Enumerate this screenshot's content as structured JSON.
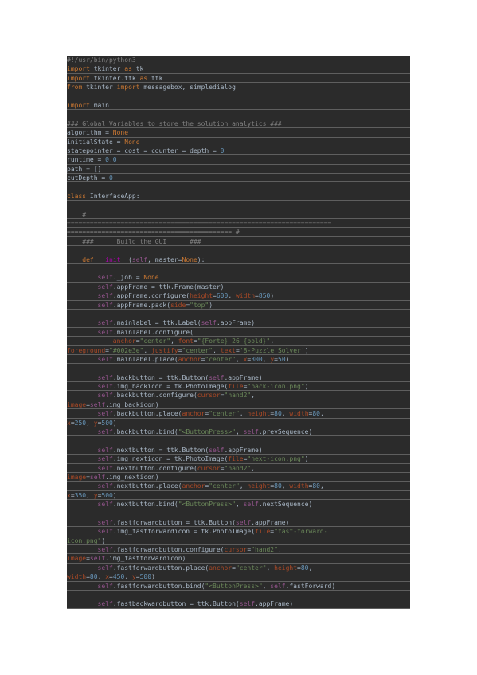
{
  "document": {
    "language": "python",
    "lines": [
      [
        [
          "#!/usr/bin/python3",
          "com"
        ]
      ],
      [
        [
          "import",
          "kw"
        ],
        [
          " tkinter ",
          ""
        ],
        [
          "as",
          "kw"
        ],
        [
          " tk",
          ""
        ]
      ],
      [
        [
          "import",
          "kw"
        ],
        [
          " tkinter.ttk ",
          ""
        ],
        [
          "as",
          "kw"
        ],
        [
          " ttk",
          ""
        ]
      ],
      [
        [
          "from",
          "kw"
        ],
        [
          " tkinter ",
          ""
        ],
        [
          "import",
          "kw"
        ],
        [
          " messagebox, simpledialog",
          ""
        ]
      ],
      [],
      [
        [
          "import",
          "kw"
        ],
        [
          " main",
          ""
        ]
      ],
      [],
      [
        [
          "### Global Variables to store the solution analytics ###",
          "com"
        ]
      ],
      [
        [
          "algorithm = ",
          ""
        ],
        [
          "None",
          "kw"
        ]
      ],
      [
        [
          "initialState = ",
          ""
        ],
        [
          "None",
          "kw"
        ]
      ],
      [
        [
          "statepointer = cost = counter = depth = ",
          ""
        ],
        [
          "0",
          "num"
        ]
      ],
      [
        [
          "runtime = ",
          ""
        ],
        [
          "0.0",
          "num"
        ]
      ],
      [
        [
          "path = []",
          ""
        ]
      ],
      [
        [
          "cutDepth = ",
          ""
        ],
        [
          "0",
          "num"
        ]
      ],
      [],
      [
        [
          "class",
          "kw"
        ],
        [
          " InterfaceApp:",
          ""
        ]
      ],
      [],
      [
        [
          "    ",
          ""
        ],
        [
          "#",
          "com"
        ]
      ],
      [
        [
          "=====================================================================",
          "com"
        ]
      ],
      [
        [
          "=========================================== #",
          "com"
        ]
      ],
      [
        [
          "    ###      Build the GUI      ###",
          "com"
        ]
      ],
      [],
      [
        [
          "    ",
          ""
        ],
        [
          "def",
          "kw"
        ],
        [
          " ",
          ""
        ],
        [
          "__init__",
          "dunder"
        ],
        [
          "(",
          ""
        ],
        [
          "self",
          "self"
        ],
        [
          ", master=",
          ""
        ],
        [
          "None",
          "kw"
        ],
        [
          "):",
          ""
        ]
      ],
      [],
      [
        [
          "        ",
          ""
        ],
        [
          "self",
          "self"
        ],
        [
          "._job = ",
          ""
        ],
        [
          "None",
          "kw"
        ]
      ],
      [
        [
          "        ",
          ""
        ],
        [
          "self",
          "self"
        ],
        [
          ".appFrame = ttk.Frame(master)",
          ""
        ]
      ],
      [
        [
          "        ",
          ""
        ],
        [
          "self",
          "self"
        ],
        [
          ".appFrame.configure(",
          ""
        ],
        [
          "height",
          "param"
        ],
        [
          "=",
          ""
        ],
        [
          "600",
          "num"
        ],
        [
          ", ",
          ""
        ],
        [
          "width",
          "param"
        ],
        [
          "=",
          ""
        ],
        [
          "850",
          "num"
        ],
        [
          ")",
          ""
        ]
      ],
      [
        [
          "        ",
          ""
        ],
        [
          "self",
          "self"
        ],
        [
          ".appFrame.pack(",
          ""
        ],
        [
          "side",
          "param"
        ],
        [
          "=",
          ""
        ],
        [
          "\"top\"",
          "str"
        ],
        [
          ")",
          ""
        ]
      ],
      [],
      [
        [
          "        ",
          ""
        ],
        [
          "self",
          "self"
        ],
        [
          ".mainlabel = ttk.Label(",
          ""
        ],
        [
          "self",
          "self"
        ],
        [
          ".appFrame)",
          ""
        ]
      ],
      [
        [
          "        ",
          ""
        ],
        [
          "self",
          "self"
        ],
        [
          ".mainlabel.configure(",
          ""
        ]
      ],
      [
        [
          "            ",
          ""
        ],
        [
          "anchor",
          "param"
        ],
        [
          "=",
          ""
        ],
        [
          "\"center\"",
          "str"
        ],
        [
          ", ",
          ""
        ],
        [
          "font",
          "param"
        ],
        [
          "=",
          ""
        ],
        [
          "\"{Forte} 26 {bold}\"",
          "str"
        ],
        [
          ",",
          ""
        ]
      ],
      [
        [
          "foreground",
          "param"
        ],
        [
          "=",
          ""
        ],
        [
          "\"#002e3e\"",
          "str"
        ],
        [
          ", ",
          ""
        ],
        [
          "justify",
          "param"
        ],
        [
          "=",
          ""
        ],
        [
          "\"center\"",
          "str"
        ],
        [
          ", ",
          ""
        ],
        [
          "text",
          "param"
        ],
        [
          "=",
          ""
        ],
        [
          "'8-Puzzle Solver'",
          "str"
        ],
        [
          ")",
          ""
        ]
      ],
      [
        [
          "        ",
          ""
        ],
        [
          "self",
          "self"
        ],
        [
          ".mainlabel.place(",
          ""
        ],
        [
          "anchor",
          "param"
        ],
        [
          "=",
          ""
        ],
        [
          "\"center\"",
          "str"
        ],
        [
          ", ",
          ""
        ],
        [
          "x",
          "param"
        ],
        [
          "=",
          ""
        ],
        [
          "300",
          "num"
        ],
        [
          ", ",
          ""
        ],
        [
          "y",
          "param"
        ],
        [
          "=",
          ""
        ],
        [
          "50",
          "num"
        ],
        [
          ")",
          ""
        ]
      ],
      [],
      [
        [
          "        ",
          ""
        ],
        [
          "self",
          "self"
        ],
        [
          ".backbutton = ttk.Button(",
          ""
        ],
        [
          "self",
          "self"
        ],
        [
          ".appFrame)",
          ""
        ]
      ],
      [
        [
          "        ",
          ""
        ],
        [
          "self",
          "self"
        ],
        [
          ".img_backicon = tk.PhotoImage(",
          ""
        ],
        [
          "file",
          "param"
        ],
        [
          "=",
          ""
        ],
        [
          "\"back-icon.png\"",
          "str"
        ],
        [
          ")",
          ""
        ]
      ],
      [
        [
          "        ",
          ""
        ],
        [
          "self",
          "self"
        ],
        [
          ".backbutton.configure(",
          ""
        ],
        [
          "cursor",
          "param"
        ],
        [
          "=",
          ""
        ],
        [
          "\"hand2\"",
          "str"
        ],
        [
          ",",
          ""
        ]
      ],
      [
        [
          "image",
          "param"
        ],
        [
          "=",
          ""
        ],
        [
          "self",
          "self"
        ],
        [
          ".img_backicon)",
          ""
        ]
      ],
      [
        [
          "        ",
          ""
        ],
        [
          "self",
          "self"
        ],
        [
          ".backbutton.place(",
          ""
        ],
        [
          "anchor",
          "param"
        ],
        [
          "=",
          ""
        ],
        [
          "\"center\"",
          "str"
        ],
        [
          ", ",
          ""
        ],
        [
          "height",
          "param"
        ],
        [
          "=",
          ""
        ],
        [
          "80",
          "num"
        ],
        [
          ", ",
          ""
        ],
        [
          "width",
          "param"
        ],
        [
          "=",
          ""
        ],
        [
          "80",
          "num"
        ],
        [
          ",",
          ""
        ]
      ],
      [
        [
          "x",
          "param"
        ],
        [
          "=",
          ""
        ],
        [
          "250",
          "num"
        ],
        [
          ", ",
          ""
        ],
        [
          "y",
          "param"
        ],
        [
          "=",
          ""
        ],
        [
          "500",
          "num"
        ],
        [
          ")",
          ""
        ]
      ],
      [
        [
          "        ",
          ""
        ],
        [
          "self",
          "self"
        ],
        [
          ".backbutton.bind(",
          ""
        ],
        [
          "\"<ButtonPress>\"",
          "str"
        ],
        [
          ", ",
          ""
        ],
        [
          "self",
          "self"
        ],
        [
          ".prevSequence)",
          ""
        ]
      ],
      [],
      [
        [
          "        ",
          ""
        ],
        [
          "self",
          "self"
        ],
        [
          ".nextbutton = ttk.Button(",
          ""
        ],
        [
          "self",
          "self"
        ],
        [
          ".appFrame)",
          ""
        ]
      ],
      [
        [
          "        ",
          ""
        ],
        [
          "self",
          "self"
        ],
        [
          ".img_nexticon = tk.PhotoImage(",
          ""
        ],
        [
          "file",
          "param"
        ],
        [
          "=",
          ""
        ],
        [
          "\"next-icon.png\"",
          "str"
        ],
        [
          ")",
          ""
        ]
      ],
      [
        [
          "        ",
          ""
        ],
        [
          "self",
          "self"
        ],
        [
          ".nextbutton.configure(",
          ""
        ],
        [
          "cursor",
          "param"
        ],
        [
          "=",
          ""
        ],
        [
          "\"hand2\"",
          "str"
        ],
        [
          ",",
          ""
        ]
      ],
      [
        [
          "image",
          "param"
        ],
        [
          "=",
          ""
        ],
        [
          "self",
          "self"
        ],
        [
          ".img_nexticon)",
          ""
        ]
      ],
      [
        [
          "        ",
          ""
        ],
        [
          "self",
          "self"
        ],
        [
          ".nextbutton.place(",
          ""
        ],
        [
          "anchor",
          "param"
        ],
        [
          "=",
          ""
        ],
        [
          "\"center\"",
          "str"
        ],
        [
          ", ",
          ""
        ],
        [
          "height",
          "param"
        ],
        [
          "=",
          ""
        ],
        [
          "80",
          "num"
        ],
        [
          ", ",
          ""
        ],
        [
          "width",
          "param"
        ],
        [
          "=",
          ""
        ],
        [
          "80",
          "num"
        ],
        [
          ",",
          ""
        ]
      ],
      [
        [
          "x",
          "param"
        ],
        [
          "=",
          ""
        ],
        [
          "350",
          "num"
        ],
        [
          ", ",
          ""
        ],
        [
          "y",
          "param"
        ],
        [
          "=",
          ""
        ],
        [
          "500",
          "num"
        ],
        [
          ")",
          ""
        ]
      ],
      [
        [
          "        ",
          ""
        ],
        [
          "self",
          "self"
        ],
        [
          ".nextbutton.bind(",
          ""
        ],
        [
          "\"<ButtonPress>\"",
          "str"
        ],
        [
          ", ",
          ""
        ],
        [
          "self",
          "self"
        ],
        [
          ".nextSequence)",
          ""
        ]
      ],
      [],
      [
        [
          "        ",
          ""
        ],
        [
          "self",
          "self"
        ],
        [
          ".fastforwardbutton = ttk.Button(",
          ""
        ],
        [
          "self",
          "self"
        ],
        [
          ".appFrame)",
          ""
        ]
      ],
      [
        [
          "        ",
          ""
        ],
        [
          "self",
          "self"
        ],
        [
          ".img_fastforwardicon = tk.PhotoImage(",
          ""
        ],
        [
          "file",
          "param"
        ],
        [
          "=",
          ""
        ],
        [
          "\"fast-forward-",
          "str"
        ]
      ],
      [
        [
          "icon.png\"",
          "str"
        ],
        [
          ")",
          ""
        ]
      ],
      [
        [
          "        ",
          ""
        ],
        [
          "self",
          "self"
        ],
        [
          ".fastforwardbutton.configure(",
          ""
        ],
        [
          "cursor",
          "param"
        ],
        [
          "=",
          ""
        ],
        [
          "\"hand2\"",
          "str"
        ],
        [
          ",",
          ""
        ]
      ],
      [
        [
          "image",
          "param"
        ],
        [
          "=",
          ""
        ],
        [
          "self",
          "self"
        ],
        [
          ".img_fastforwardicon)",
          ""
        ]
      ],
      [
        [
          "        ",
          ""
        ],
        [
          "self",
          "self"
        ],
        [
          ".fastforwardbutton.place(",
          ""
        ],
        [
          "anchor",
          "param"
        ],
        [
          "=",
          ""
        ],
        [
          "\"center\"",
          "str"
        ],
        [
          ", ",
          ""
        ],
        [
          "height",
          "param"
        ],
        [
          "=",
          ""
        ],
        [
          "80",
          "num"
        ],
        [
          ",",
          ""
        ]
      ],
      [
        [
          "width",
          "param"
        ],
        [
          "=",
          ""
        ],
        [
          "80",
          "num"
        ],
        [
          ", ",
          ""
        ],
        [
          "x",
          "param"
        ],
        [
          "=",
          ""
        ],
        [
          "450",
          "num"
        ],
        [
          ", ",
          ""
        ],
        [
          "y",
          "param"
        ],
        [
          "=",
          ""
        ],
        [
          "500",
          "num"
        ],
        [
          ")",
          ""
        ]
      ],
      [
        [
          "        ",
          ""
        ],
        [
          "self",
          "self"
        ],
        [
          ".fastforwardbutton.bind(",
          ""
        ],
        [
          "\"<ButtonPress>\"",
          "str"
        ],
        [
          ", ",
          ""
        ],
        [
          "self",
          "self"
        ],
        [
          ".fastForward)",
          ""
        ]
      ],
      [],
      [
        [
          "        ",
          ""
        ],
        [
          "self",
          "self"
        ],
        [
          ".fastbackwardbutton = ttk.Button(",
          ""
        ],
        [
          "self",
          "self"
        ],
        [
          ".appFrame)",
          ""
        ]
      ]
    ]
  }
}
